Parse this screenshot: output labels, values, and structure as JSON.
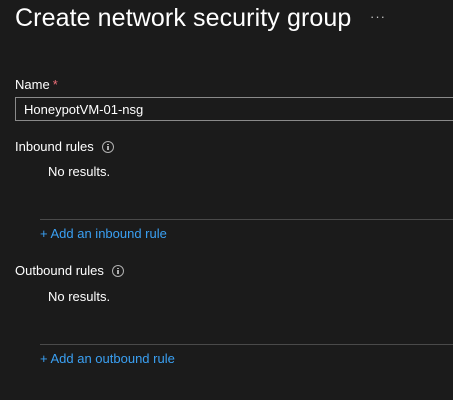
{
  "page": {
    "title": "Create network security group",
    "more_icon_glyph": "···"
  },
  "name_field": {
    "label": "Name",
    "required_mark": "*",
    "value": "HoneypotVM-01-nsg"
  },
  "inbound": {
    "label": "Inbound rules",
    "empty_text": "No results.",
    "add_link": "+ Add an inbound rule"
  },
  "outbound": {
    "label": "Outbound rules",
    "empty_text": "No results.",
    "add_link": "+ Add an outbound rule"
  },
  "colors": {
    "background": "#1b1b1b",
    "link": "#3aa0f3",
    "required": "#f1707b"
  }
}
